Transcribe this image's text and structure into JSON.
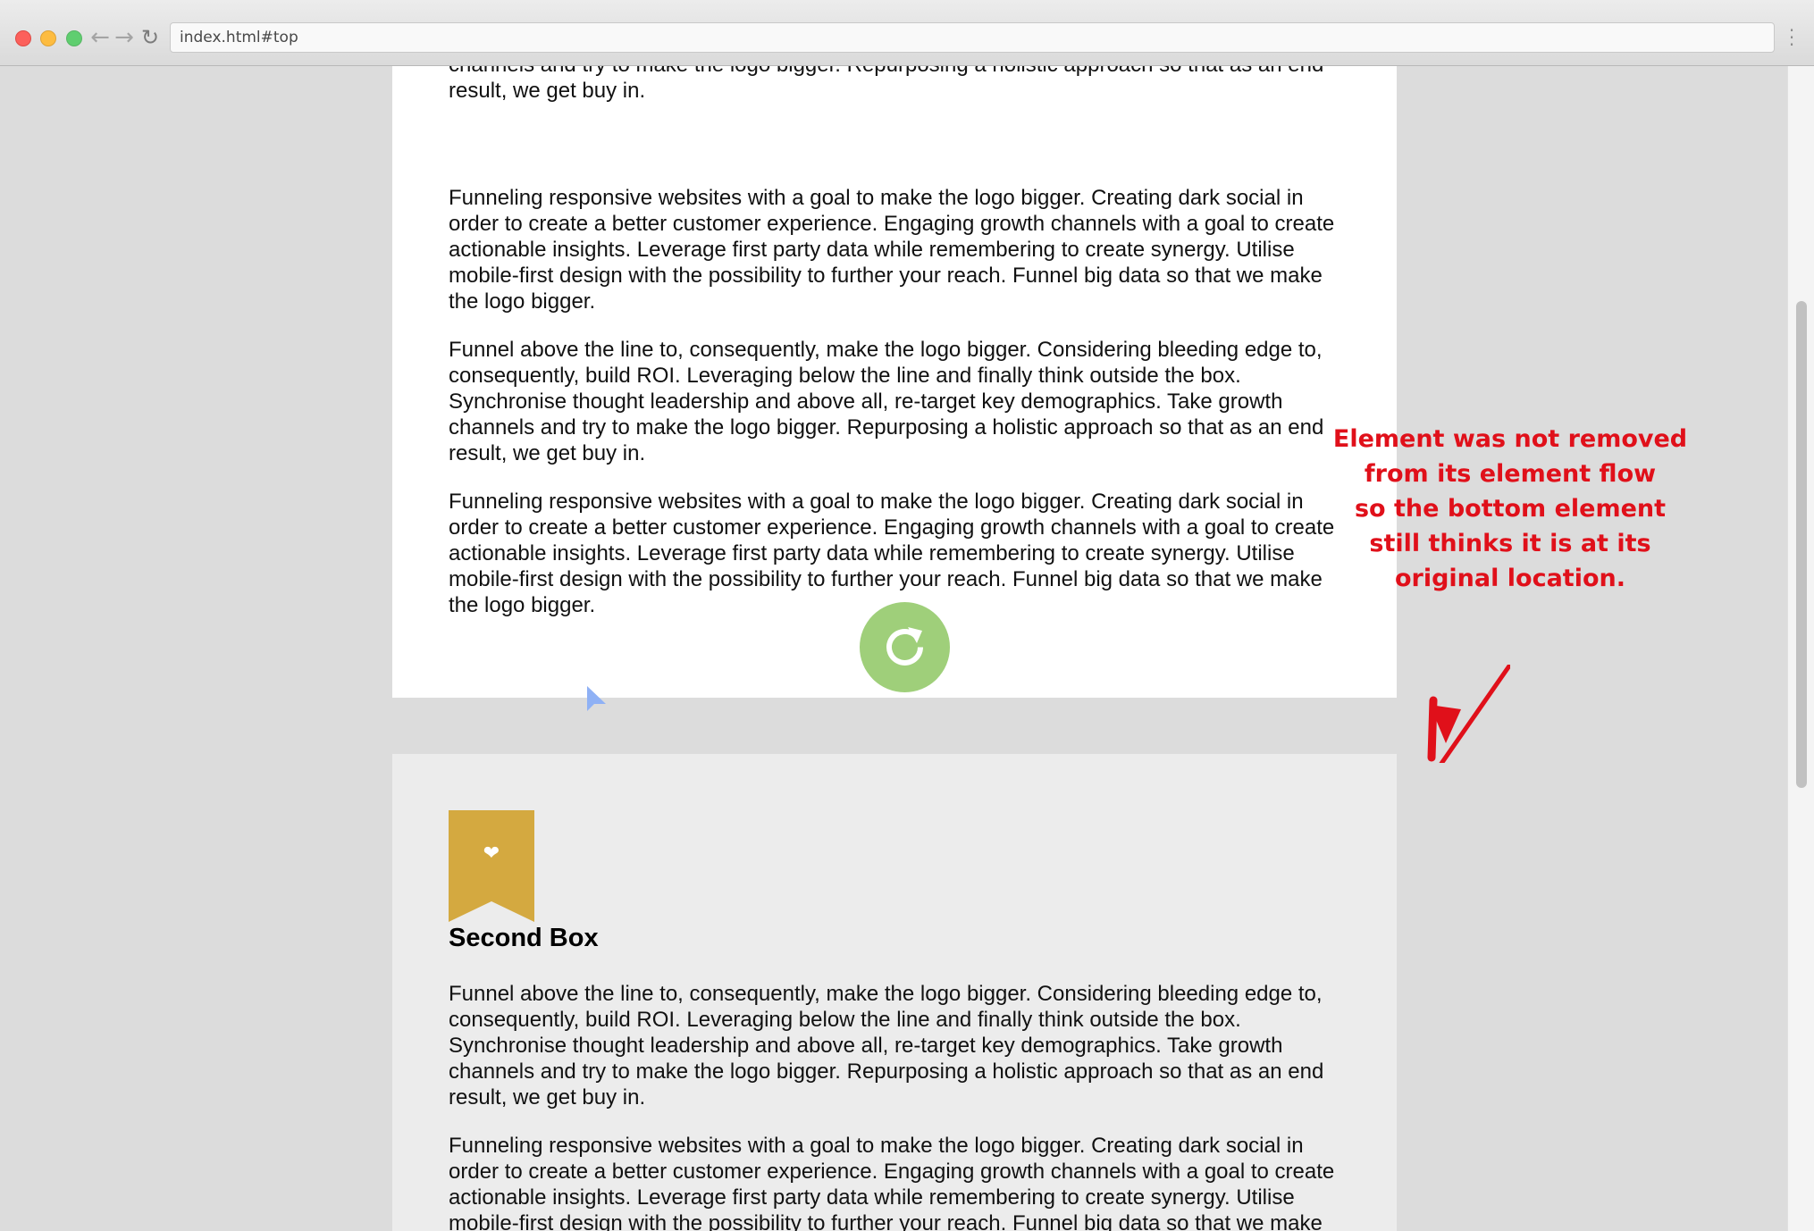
{
  "browser": {
    "url": "index.html#top",
    "back_icon": "←",
    "forward_icon": "→",
    "reload_icon": "↻",
    "menu_icon": "⋮"
  },
  "first_box": {
    "paragraphs": [
      "Funnel above the line to, consequently, make the logo bigger. Considering bleeding edge to, consequently, build ROI. Leveraging below the line and finally think outside the box. Synchronise thought leadership and above all, re-target key demographics. Take growth channels and try to make the logo bigger. Repurposing a holistic approach so that as an end result, we get buy in.",
      "Funneling responsive websites with a goal to make the logo bigger. Creating dark social in order to create a better customer experience. Engaging growth channels with a goal to create actionable insights. Leverage first party data while remembering to create synergy. Utilise mobile-first design with the possibility to further your reach. Funnel big data so that we make the logo bigger.",
      "Funnel above the line to, consequently, make the logo bigger. Considering bleeding edge to, consequently, build ROI. Leveraging below the line and finally think outside the box. Synchronise thought leadership and above all, re-target key demographics. Take growth channels and try to make the logo bigger. Repurposing a holistic approach so that as an end result, we get buy in.",
      "Funneling responsive websites with a goal to make the logo bigger. Creating dark social in order to create a better customer experience. Engaging growth channels with a goal to create actionable insights. Leverage first party data while remembering to create synergy. Utilise mobile-first design with the possibility to further your reach. Funnel big data so that we make the logo bigger."
    ]
  },
  "second_box": {
    "title": "Second Box",
    "bookmark_icon": "❤",
    "paragraphs": [
      "Funnel above the line to, consequently, make the logo bigger. Considering bleeding edge to, consequently, build ROI. Leveraging below the line and finally think outside the box. Synchronise thought leadership and above all, re-target key demographics. Take growth channels and try to make the logo bigger. Repurposing a holistic approach so that as an end result, we get buy in.",
      "Funneling responsive websites with a goal to make the logo bigger. Creating dark social in order to create a better customer experience. Engaging growth channels with a goal to create actionable insights. Leverage first party data while remembering to create synergy. Utilise mobile-first design with the possibility to further your reach. Funnel big data so that we make the logo bigger."
    ]
  },
  "annotation": {
    "lines": [
      "Element was not removed",
      "from its element flow",
      "so the bottom element",
      "still thinks it is at its",
      "original location."
    ]
  },
  "colors": {
    "annotation": "#e0101a",
    "bookmark": "#d4a940",
    "reload_fab": "#9fcf7a",
    "cursor": "#8fb1f5"
  },
  "icons": {
    "fab": "reload-icon",
    "bookmark": "heart-icon",
    "cursor": "pointer-cursor-icon"
  }
}
